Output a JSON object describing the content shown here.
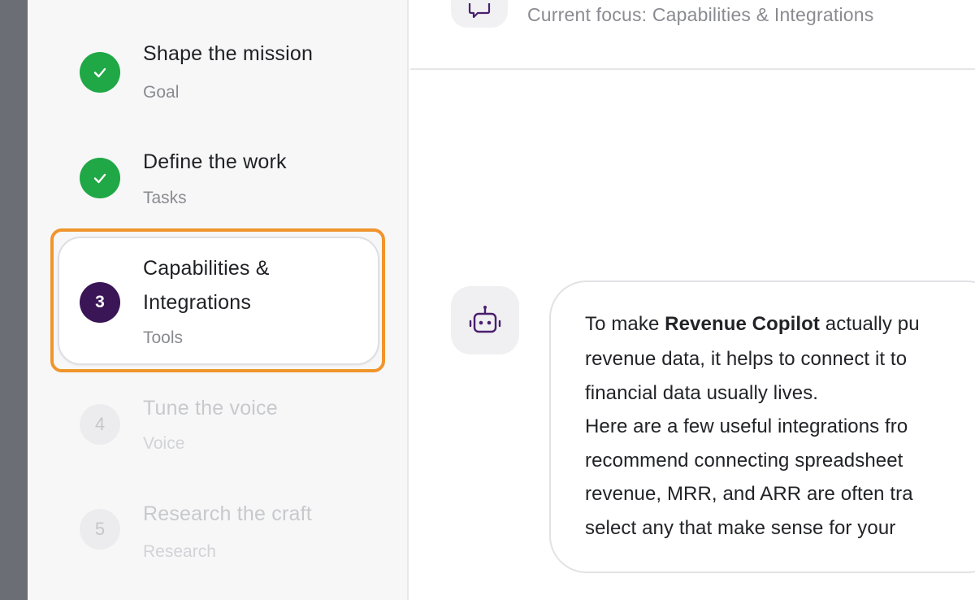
{
  "header": {
    "focus_text": "Current focus: Capabilities & Integrations"
  },
  "steps": [
    {
      "status": "done",
      "marker": "",
      "title": "Shape the mission",
      "subtitle": "Goal"
    },
    {
      "status": "done",
      "marker": "",
      "title": "Define the work",
      "subtitle": "Tasks"
    },
    {
      "status": "active",
      "marker": "3",
      "title_line1": "Capabilities &",
      "title_line2": "Integrations",
      "subtitle": "Tools"
    },
    {
      "status": "pending",
      "marker": "4",
      "title": "Tune the voice",
      "subtitle": "Voice"
    },
    {
      "status": "pending",
      "marker": "5",
      "title": "Research the craft",
      "subtitle": "Research"
    }
  ],
  "message": {
    "line1_prefix": "To make ",
    "line1_bold": "Revenue Copilot",
    "line1_suffix": " actually pu",
    "line2": "revenue data, it helps to connect it to",
    "line3": "financial data usually lives.",
    "line4": "Here are a few useful integrations fro",
    "line5": "recommend connecting spreadsheet",
    "line6": "revenue, MRR, and ARR are often tra",
    "line7": "select any that make sense for your "
  },
  "colors": {
    "done": "#1fa845",
    "active": "#3a1656",
    "highlight": "#f0952c",
    "bot_icon": "#4a1f6e"
  }
}
